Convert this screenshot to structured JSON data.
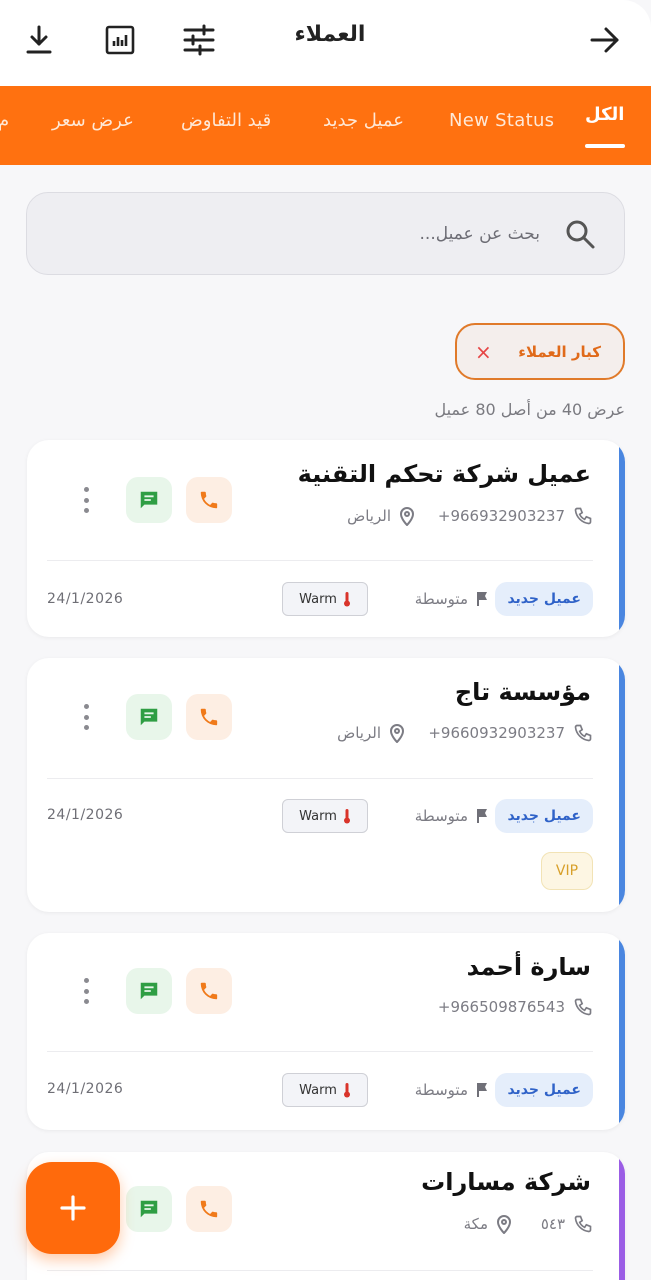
{
  "header": {
    "title": "العملاء",
    "icons": [
      "download-icon",
      "report-icon",
      "filter-sliders-icon",
      "back-arrow-icon"
    ]
  },
  "tabs": [
    {
      "label": "الكل",
      "active": true
    },
    {
      "label": "New Status"
    },
    {
      "label": "عميل جديد"
    },
    {
      "label": "قيد التفاوض"
    },
    {
      "label": "عرض سعر"
    },
    {
      "label": "م"
    }
  ],
  "search": {
    "placeholder": "بحث عن عميل..."
  },
  "filter_chip": {
    "label": "كبار العملاء",
    "remove": "×"
  },
  "results_count": "عرض 40 من أصل 80 عميل",
  "colors": {
    "accent": "#ff7110",
    "edge_blue": "#4a86e0",
    "edge_purple": "#9b5de5"
  },
  "customers": [
    {
      "name": "عميل شركة تحكم التقنية",
      "phone": "+966932903237",
      "city": "الرياض",
      "status": "عميل جديد",
      "priority": "متوسطة",
      "temperature": "Warm",
      "date": "24/1/2026"
    },
    {
      "name": "مؤسسة تاج",
      "phone": "+9660932903237",
      "city": "الرياض",
      "status": "عميل جديد",
      "priority": "متوسطة",
      "temperature": "Warm",
      "date": "24/1/2026",
      "tag": "VIP"
    },
    {
      "name": "سارة أحمد",
      "phone": "+966509876543",
      "status": "عميل جديد",
      "priority": "متوسطة",
      "temperature": "Warm",
      "date": "24/1/2026"
    },
    {
      "name": "شركة مسارات",
      "phone": "٥٤٣",
      "city": "مكة"
    }
  ],
  "fab": {
    "icon": "plus-icon",
    "label": "+"
  }
}
